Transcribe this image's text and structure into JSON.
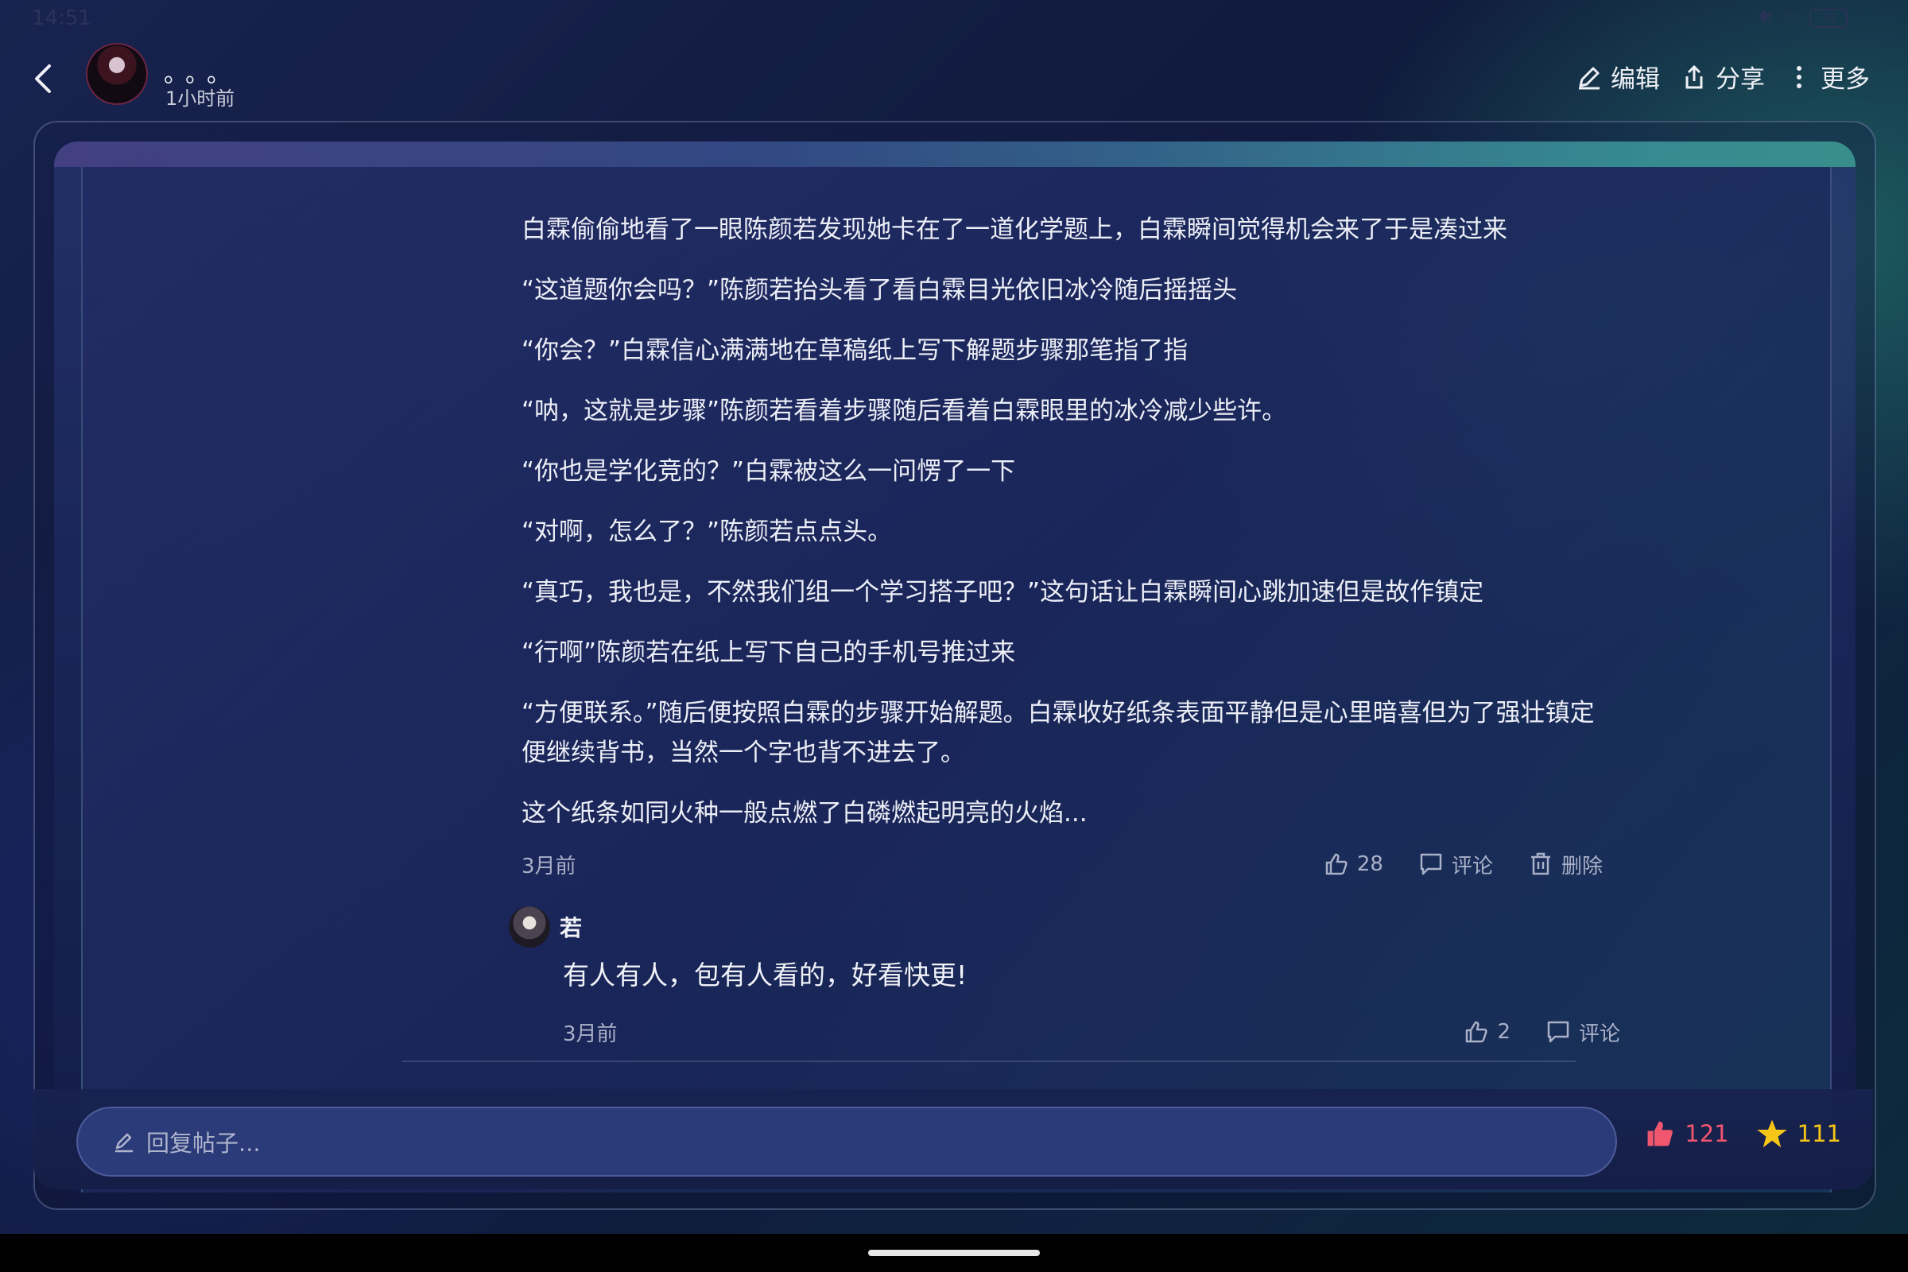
{
  "status": {
    "time": "14:51",
    "battery": "74"
  },
  "header": {
    "username": "。。。",
    "time_ago": "1小时前",
    "actions": {
      "edit": "编辑",
      "share": "分享",
      "more": "更多"
    }
  },
  "post": {
    "paragraphs": [
      "白霖偷偷地看了一眼陈颜若发现她卡在了一道化学题上，白霖瞬间觉得机会来了于是凑过来",
      "“这道题你会吗？”陈颜若抬头看了看白霖目光依旧冰冷随后摇摇头",
      "“你会？”白霖信心满满地在草稿纸上写下解题步骤那笔指了指",
      "“呐，这就是步骤”陈颜若看着步骤随后看着白霖眼里的冰冷减少些许。",
      "“你也是学化竞的？”白霖被这么一问愣了一下",
      "“对啊，怎么了？”陈颜若点点头。",
      "“真巧，我也是，不然我们组一个学习搭子吧？”这句话让白霖瞬间心跳加速但是故作镇定",
      "“行啊”陈颜若在纸上写下自己的手机号推过来",
      "“方便联系。”随后便按照白霖的步骤开始解题。白霖收好纸条表面平静但是心里暗喜但为了强壮镇定便继续背书，当然一个字也背不进去了。",
      "这个纸条如同火种一般点燃了白磷燃起明亮的火焰..."
    ],
    "time": "3月前",
    "likes": "28",
    "comment_label": "评论",
    "delete_label": "删除"
  },
  "reply": {
    "name": "若",
    "text": "有人有人，包有人看的，好看快更!",
    "time": "3月前",
    "likes": "2",
    "comment_label": "评论"
  },
  "bottom": {
    "placeholder": "回复帖子...",
    "like_count": "121",
    "star_count": "111",
    "like_color": "#f0566e",
    "star_color": "#f5c518"
  }
}
